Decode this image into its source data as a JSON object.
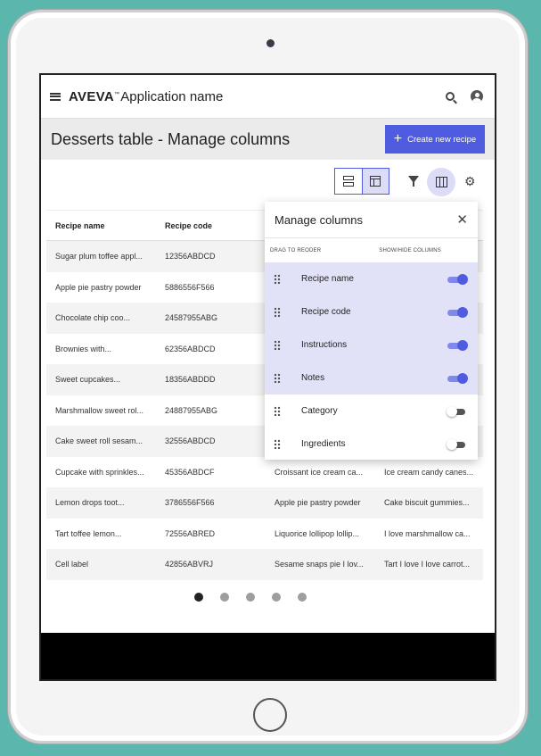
{
  "appbar": {
    "brand": "AVEVA",
    "trademark": "™",
    "app_name": "Application name"
  },
  "header": {
    "title": "Desserts table - Manage columns",
    "create_button": "Create new recipe"
  },
  "table": {
    "columns": [
      "Recipe name",
      "Recipe code"
    ],
    "rows": [
      [
        "Sugar plum toffee appl...",
        "12356ABDCD",
        "",
        ""
      ],
      [
        "Apple pie pastry powder",
        "5886556F566",
        "",
        ""
      ],
      [
        "Chocolate chip coo...",
        "24587955ABG",
        "",
        ""
      ],
      [
        "Brownies with...",
        "62356ABDCD",
        "",
        ""
      ],
      [
        "Sweet cupcakes...",
        "18356ABDDD",
        "",
        ""
      ],
      [
        "Marshmallow sweet rol...",
        "24887955ABG",
        "",
        ""
      ],
      [
        "Cake sweet roll sesam...",
        "32556ABDCD",
        "",
        ""
      ],
      [
        "Cupcake with sprinkles...",
        "45356ABDCF",
        "Croissant ice cream ca...",
        "Ice cream candy canes..."
      ],
      [
        "Lemon drops toot...",
        "3786556F566",
        "Apple pie pastry powder",
        "Cake biscuit gummies..."
      ],
      [
        "Tart toffee lemon...",
        "72556ABRED",
        "Liquorice lollipop lollip...",
        "I love marshmallow ca..."
      ],
      [
        "Cell label",
        "42856ABVRJ",
        "Sesame snaps pie I lov...",
        "Tart I love I love carrot..."
      ]
    ]
  },
  "pagination": {
    "pages": 5,
    "active": 1
  },
  "manage_columns": {
    "title": "Manage columns",
    "drag_label": "DRAG TO REODER",
    "toggle_label": "SHOW/HIDE COLUMNS",
    "items": [
      {
        "label": "Recipe name",
        "visible": true
      },
      {
        "label": "Recipe code",
        "visible": true
      },
      {
        "label": "Instructions",
        "visible": true
      },
      {
        "label": "Notes",
        "visible": true
      },
      {
        "label": "Category",
        "visible": false
      },
      {
        "label": "Ingredients",
        "visible": false
      }
    ]
  },
  "colors": {
    "accent": "#4f5ce0",
    "accent_light": "#e1e2f7",
    "header_bg": "#ebebeb"
  }
}
